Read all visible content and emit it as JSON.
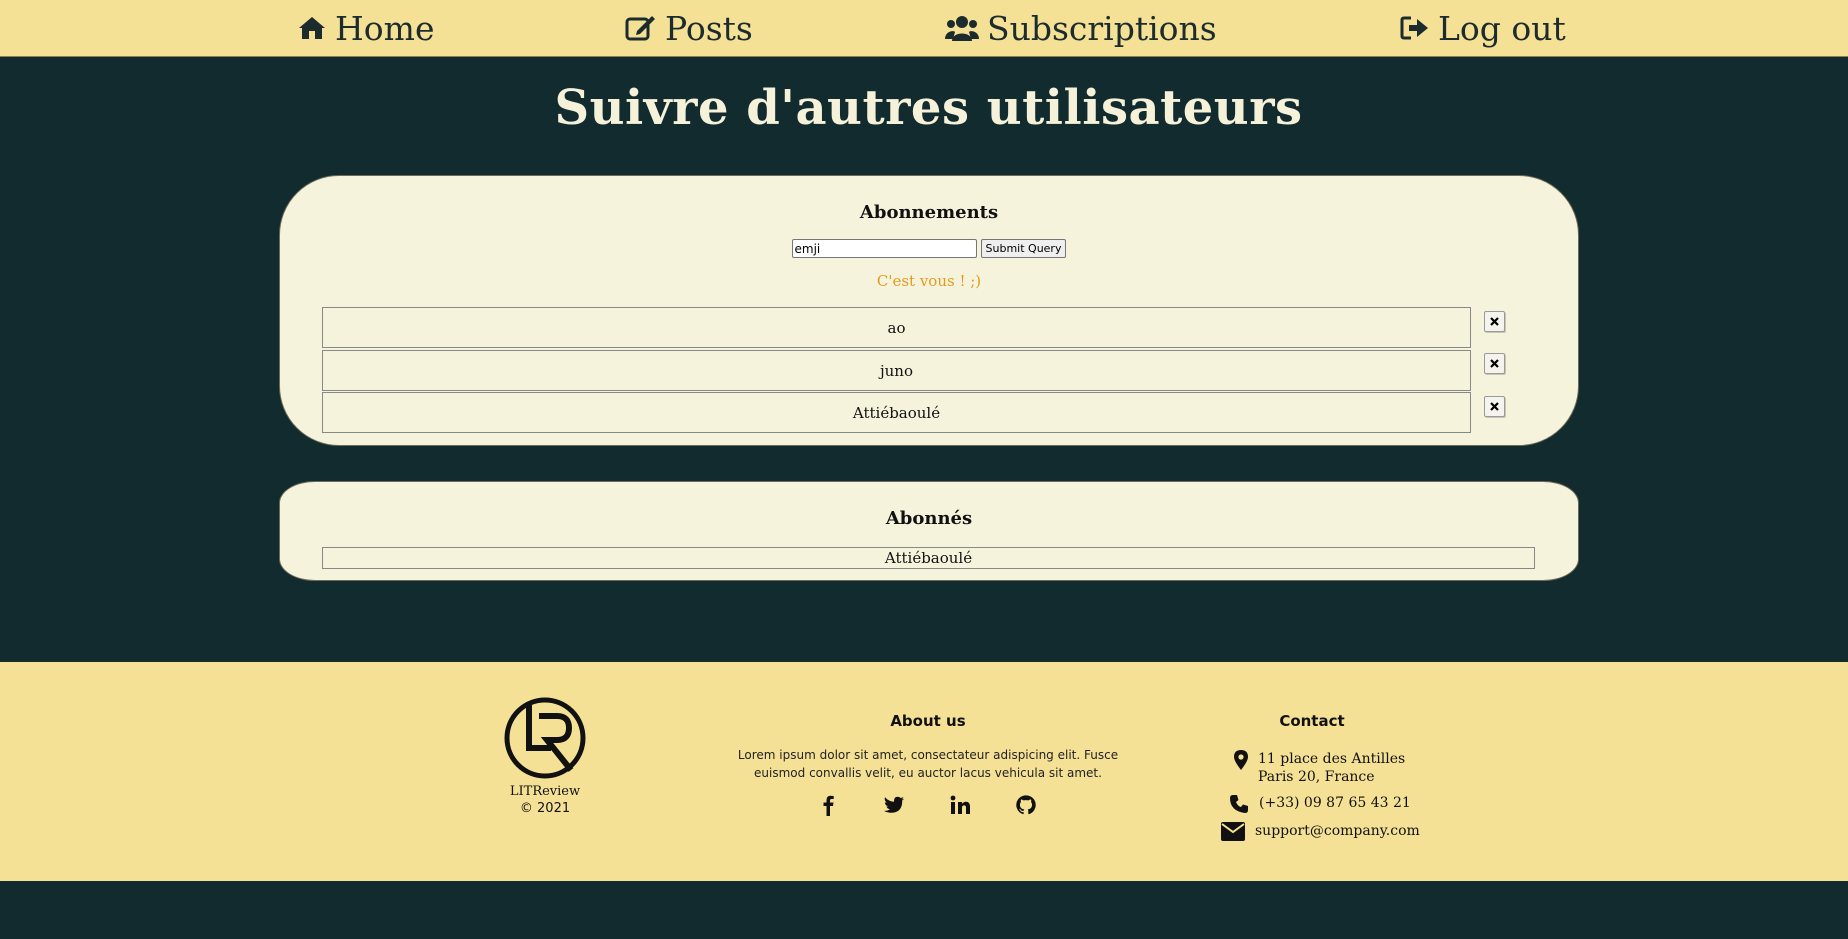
{
  "nav": {
    "items": [
      {
        "label": "Home",
        "icon": "home-icon"
      },
      {
        "label": "Posts",
        "icon": "edit-icon"
      },
      {
        "label": "Subscriptions",
        "icon": "users-icon"
      },
      {
        "label": "Log out",
        "icon": "sign-out-icon"
      }
    ]
  },
  "page": {
    "title": "Suivre d'autres utilisateurs"
  },
  "subscriptions": {
    "heading": "Abonnements",
    "search": {
      "value": "emji",
      "submit_label": "Submit Query"
    },
    "notice": "C'est vous ! ;)",
    "remove_icon": "close-icon",
    "users": [
      "ao",
      "juno",
      "Attiébaoulé"
    ]
  },
  "followers": {
    "heading": "Abonnés",
    "users": [
      "Attiébaoulé"
    ]
  },
  "footer": {
    "brand": {
      "name": "LITReview",
      "copyright": "© 2021",
      "logo": "litreview-logo"
    },
    "about": {
      "heading": "About us",
      "text_line1": "Lorem ipsum dolor sit amet, consectateur adispicing elit. Fusce",
      "text_line2": "euismod convallis velit, eu auctor lacus vehicula sit amet.",
      "social": [
        "facebook-icon",
        "twitter-icon",
        "linkedin-icon",
        "github-icon"
      ]
    },
    "contact": {
      "heading": "Contact",
      "address_line1": "11 place des Antilles",
      "address_line2": "Paris 20, France",
      "phone": "(+33) 09 87 65 43 21",
      "email": "support@company.com"
    }
  },
  "colors": {
    "bar": "#f5e196",
    "background": "#112b2f",
    "card": "#f6f3dc",
    "notice": "#e39b1f"
  }
}
